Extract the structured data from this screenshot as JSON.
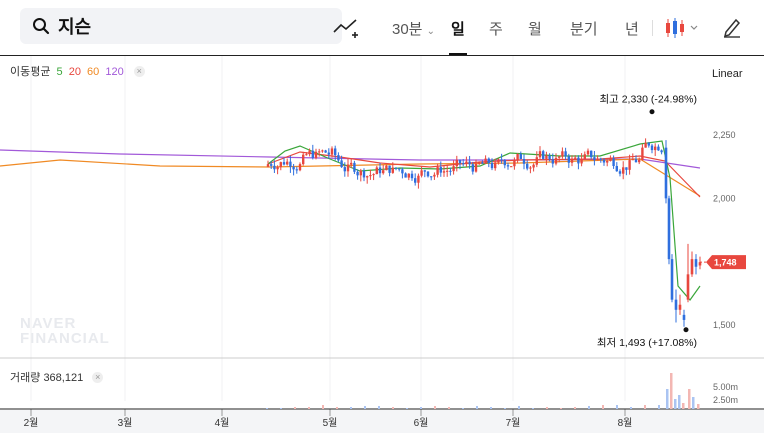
{
  "search": {
    "query": "지슨"
  },
  "toolbar": {
    "interval": "30분",
    "periods": [
      "일",
      "주",
      "월",
      "분기",
      "년"
    ],
    "active_period": "일"
  },
  "colors": {
    "up": "#e8473e",
    "down": "#2f6fde",
    "ma5": "#3aa63a",
    "ma20": "#e8473e",
    "ma60": "#f08a24",
    "ma120": "#a259d9"
  },
  "legend": {
    "title": "이동평균",
    "periods": [
      "5",
      "20",
      "60",
      "120"
    ],
    "close_icon": "×"
  },
  "scale_mode": "Linear",
  "volume": {
    "label": "거래량",
    "value": "368,121",
    "axis": [
      "5.00m",
      "2.50m"
    ]
  },
  "watermark": [
    "NAVER",
    "FINANCIAL"
  ],
  "chart_data": {
    "type": "candlestick",
    "y_ticks": [
      2250,
      2000,
      1750,
      1500
    ],
    "ylim": [
      1460,
      2470
    ],
    "x_ticks": [
      "2월",
      "3월",
      "4월",
      "5월",
      "6월",
      "7월",
      "8월"
    ],
    "last_price": "1,748",
    "high_annotation": {
      "label": "최고",
      "value": "2,330",
      "change": "(-24.98%)"
    },
    "low_annotation": {
      "label": "최저",
      "value": "1,493",
      "change": "(+17.08%)"
    },
    "ma_series": [
      {
        "period": 120,
        "points": [
          [
            "2월 초",
            2188
          ],
          [
            "4월 초",
            2145
          ],
          [
            "5월 초",
            2133
          ],
          [
            "6월 초",
            2128
          ],
          [
            "7월 초",
            2133
          ],
          [
            "8월 중",
            2133
          ],
          [
            "8월 말",
            2115
          ]
        ]
      },
      {
        "period": 60,
        "points": [
          [
            "2월 초",
            2170
          ],
          [
            "2월 말",
            2140
          ],
          [
            "5월 초",
            2130
          ],
          [
            "6월 초",
            2125
          ],
          [
            "7월 초",
            2128
          ],
          [
            "8월 중",
            2140
          ],
          [
            "8월 말",
            2130
          ]
        ]
      },
      {
        "period": 20,
        "points": [
          [
            "4월 말",
            2128
          ],
          [
            "5월 초",
            2150
          ],
          [
            "6월 초",
            2110
          ],
          [
            "7월 초",
            2128
          ],
          [
            "8월 중",
            2150
          ],
          [
            "8월 말",
            2010
          ]
        ]
      },
      {
        "period": 5,
        "points": [
          [
            "4월 말",
            2150
          ],
          [
            "5월 초",
            2200
          ],
          [
            "5월 중",
            2105
          ],
          [
            "6월 중",
            2105
          ],
          [
            "7월 초",
            2190
          ],
          [
            "8월 중",
            2270
          ],
          [
            "8월 말",
            1600
          ],
          [
            "8월 말+",
            1690
          ]
        ]
      }
    ]
  }
}
